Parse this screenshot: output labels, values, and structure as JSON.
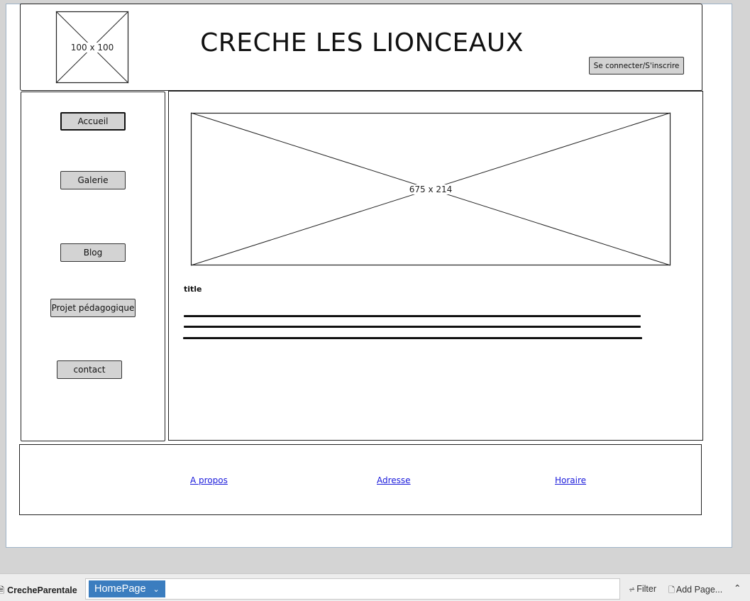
{
  "header": {
    "logo_placeholder": "100 x 100",
    "site_title": "CRECHE LES LIONCEAUX",
    "login_button": "Se connecter/S'inscrire"
  },
  "sidebar": {
    "items": [
      {
        "label": "Accueil",
        "selected": true
      },
      {
        "label": "Galerie"
      },
      {
        "label": "Blog"
      },
      {
        "label": "Projet pédagogique"
      },
      {
        "label": "contact"
      }
    ]
  },
  "main": {
    "banner_placeholder": "675 x 214",
    "text_title": "title"
  },
  "footer": {
    "links": [
      "A propos",
      "Adresse",
      "Horaire"
    ]
  },
  "pagebar": {
    "project_icon": "file-icon",
    "project_name": "CrecheParentale",
    "active_page": "HomePage",
    "filter_label": "Filter",
    "filter_icon": "filter-icon",
    "add_page_label": "Add Page...",
    "add_page_icon": "add-page-icon",
    "collapse_icon": "chevron-up-icon"
  },
  "colors": {
    "background": "#d4d4d4",
    "canvas": "#ffffff",
    "button_fill": "#d3d3d3",
    "link": "#1a1adb",
    "page_tab": "#3b7dbf"
  }
}
